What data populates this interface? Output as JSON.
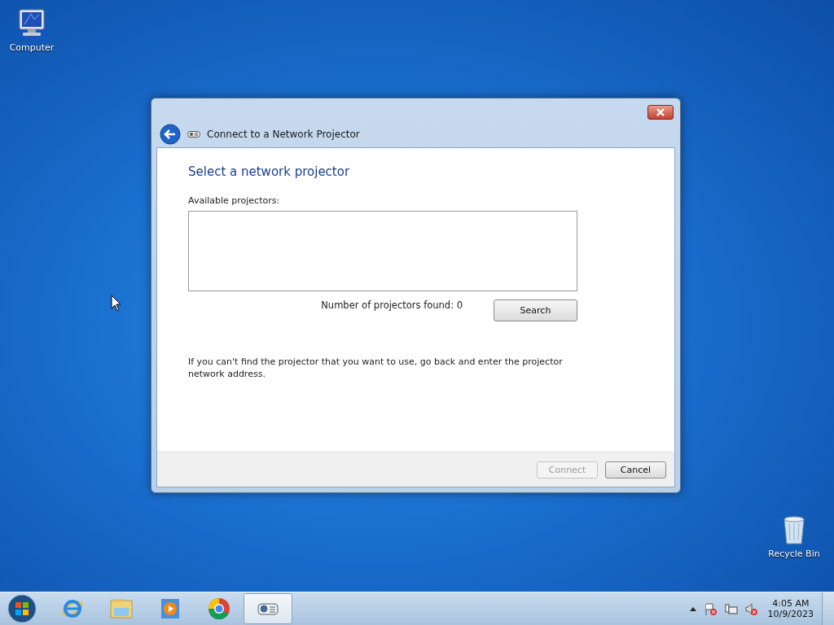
{
  "desktop_icons": [
    {
      "kind": "computer",
      "label": "Computer"
    },
    {
      "kind": "recycle",
      "label": "Recycle Bin"
    }
  ],
  "window": {
    "title": "Connect to a Network Projector",
    "heading": "Select a network projector",
    "list_label": "Available projectors:",
    "found_text": "Number of projectors found: 0",
    "search_button": "Search",
    "hint": "If you can't find the projector that you want to use, go back and enter the projector network address.",
    "buttons": [
      {
        "label": "Connect",
        "disabled": true
      },
      {
        "label": "Cancel",
        "disabled": false
      }
    ]
  },
  "taskbar": {
    "apps": [
      {
        "kind": "ie",
        "selected": false
      },
      {
        "kind": "explorer",
        "selected": false
      },
      {
        "kind": "media",
        "selected": false
      },
      {
        "kind": "chrome",
        "selected": false
      },
      {
        "kind": "projector",
        "selected": true
      }
    ],
    "time": "4:05 AM",
    "date": "10/9/2023"
  }
}
